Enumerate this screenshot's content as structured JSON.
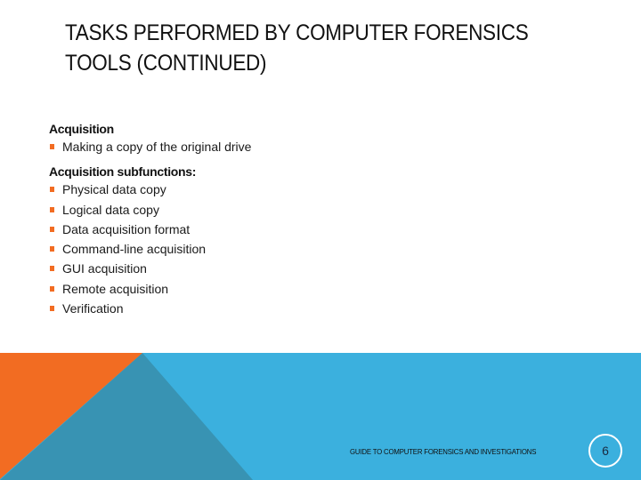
{
  "slide": {
    "title_lines": [
      "TASKS PERFORMED BY COMPUTER FORENSICS",
      "TOOLS (CONTINUED)"
    ],
    "sections": [
      {
        "heading": "Acquisition",
        "bullets": [
          "Making a copy of the original drive"
        ]
      },
      {
        "heading": "Acquisition subfunctions:",
        "bullets": [
          "Physical data copy",
          "Logical data copy",
          "Data acquisition format",
          "Command-line acquisition",
          "GUI acquisition",
          "Remote acquisition",
          "Verification"
        ]
      }
    ],
    "footer": "GUIDE TO COMPUTER FORENSICS AND INVESTIGATIONS",
    "page_number": "6"
  },
  "colors": {
    "accent_orange": "#f26c22",
    "band_blue": "#3bb0de",
    "band_dark_teal": "#3893b3",
    "bullet": "#f26c22"
  }
}
